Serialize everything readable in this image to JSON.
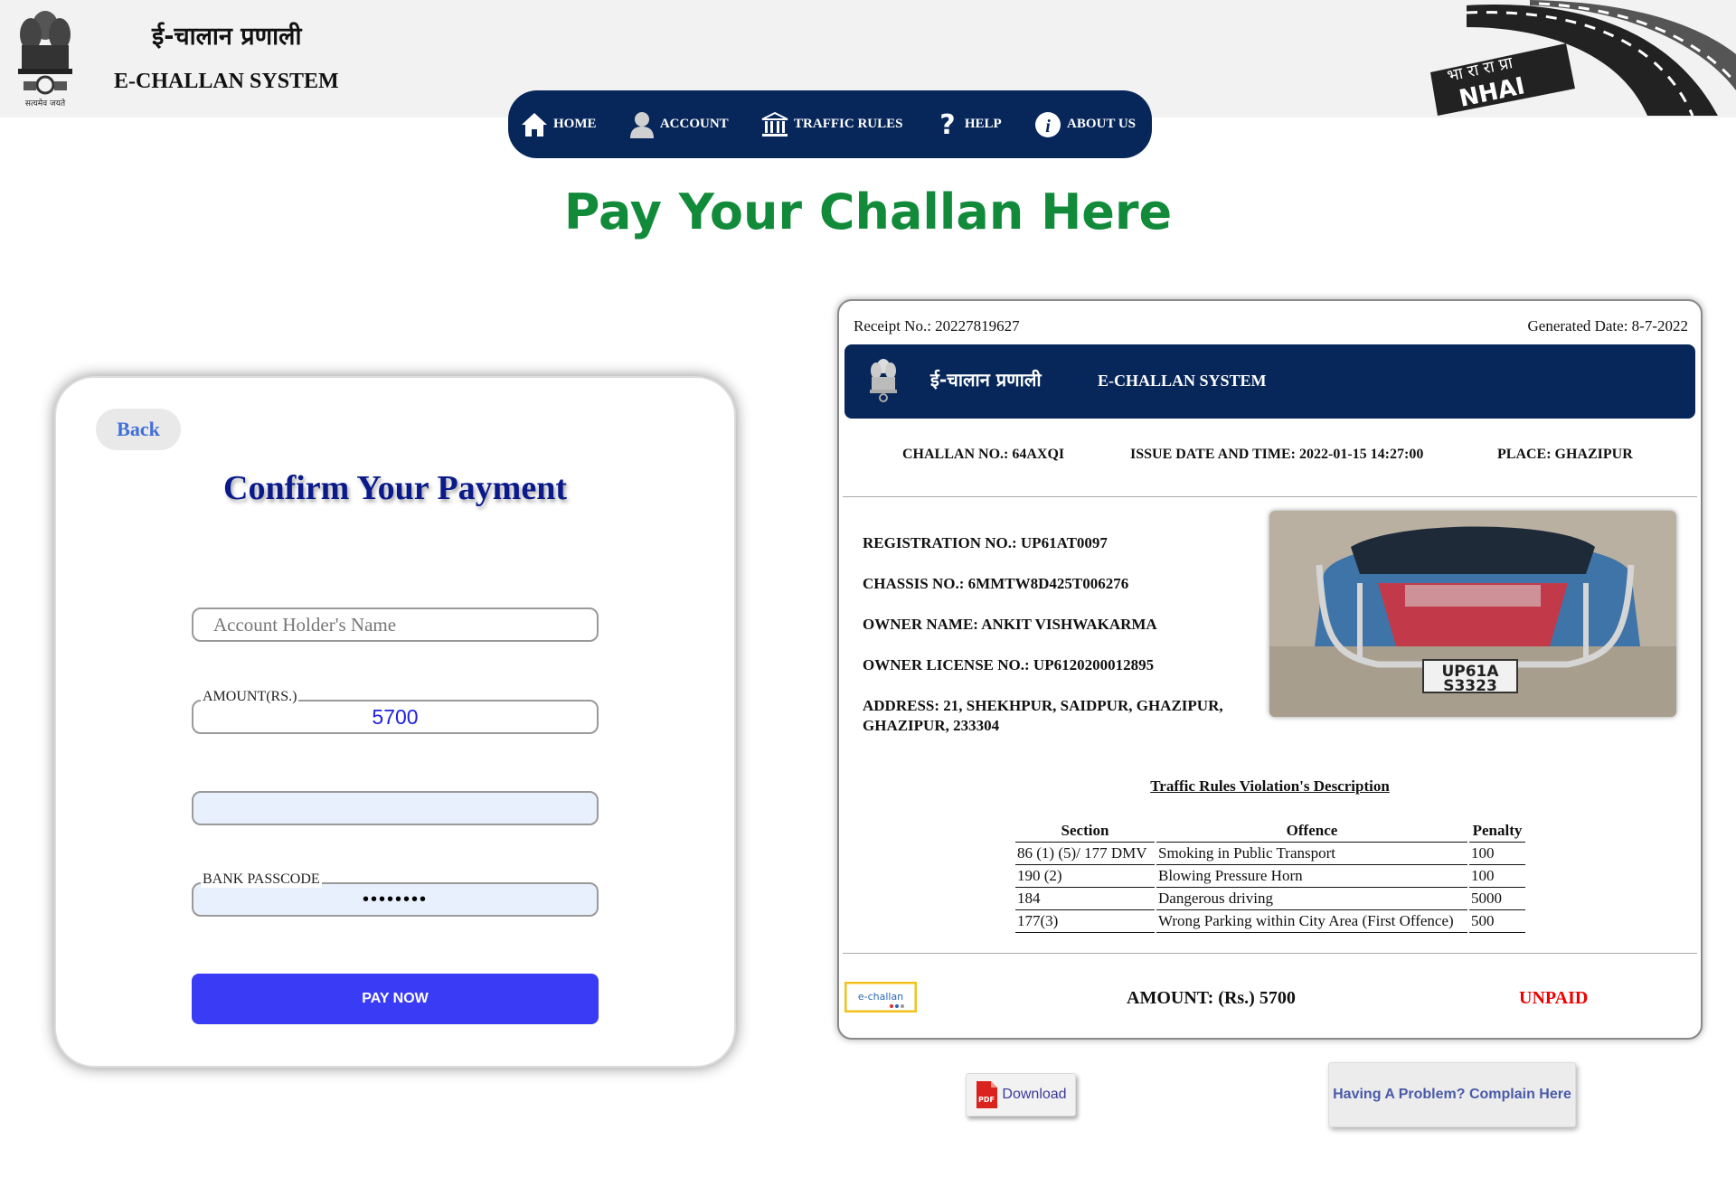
{
  "header": {
    "hindi_title": "ई-चालान प्रणाली",
    "english_title": "E-CHALLAN SYSTEM",
    "emblem_motto": "सत्यमेव जयते",
    "nhai_text": "NHAI",
    "nhai_hindi": "भा रा रा प्रा"
  },
  "nav": {
    "items": [
      {
        "label": "HOME",
        "icon": "home-icon"
      },
      {
        "label": "ACCOUNT",
        "icon": "user-icon"
      },
      {
        "label": "TRAFFIC RULES",
        "icon": "bank-building-icon"
      },
      {
        "label": "HELP",
        "icon": "question-icon"
      },
      {
        "label": "ABOUT US",
        "icon": "info-icon"
      }
    ],
    "bg_color": "#07275a"
  },
  "page_title": "Pay Your Challan Here",
  "payment": {
    "back_label": "Back",
    "title": "Confirm Your Payment",
    "name_placeholder": "Account Holder's Name",
    "name_value": "",
    "amount_label": "AMOUNT(RS.)",
    "amount_value": "5700",
    "blank_value": "",
    "passcode_label": "BANK PASSCODE",
    "passcode_value": "••••••••",
    "pay_button": "PAY NOW",
    "button_color": "#3a3cf5"
  },
  "receipt": {
    "receipt_no": "Receipt No.: 20227819627",
    "generated_date": "Generated Date: 8-7-2022",
    "band_hindi": "ई-चालान प्रणाली",
    "band_english": "E-CHALLAN SYSTEM",
    "challan_no": "CHALLAN NO.: 64AXQI",
    "issue_datetime": "ISSUE DATE AND TIME: 2022-01-15 14:27:00",
    "place": "PLACE: GHAZIPUR",
    "registration_no": "REGISTRATION NO.: UP61AT0097",
    "chassis_no": "CHASSIS NO.: 6MMTW8D425T006276",
    "owner_name": "OWNER NAME: ANKIT VISHWAKARMA",
    "owner_license": "OWNER LICENSE NO.: UP6120200012895",
    "address_line1": "ADDRESS: 21, SHEKHPUR, SAIDPUR, GHAZIPUR,",
    "address_line2": "GHAZIPUR, 233304",
    "plate_line1": "UP61A",
    "plate_line2": "S3323",
    "violation_title": "Traffic Rules Violation's Description",
    "table": {
      "headers": [
        "Section",
        "Offence",
        "Penalty"
      ],
      "rows": [
        [
          "86 (1) (5)/ 177 DMV",
          "Smoking in Public Transport",
          "100"
        ],
        [
          "190 (2)",
          "Blowing Pressure Horn",
          "100"
        ],
        [
          "184",
          "Dangerous driving",
          "5000"
        ],
        [
          "177(3)",
          "Wrong Parking within City Area (First Offence)",
          "500"
        ]
      ]
    },
    "logo_text": "e-challan",
    "amount": "AMOUNT: (Rs.) 5700",
    "status": "UNPAID",
    "status_color": "#f00000"
  },
  "actions": {
    "download_label": "Download",
    "pdf_badge": "PDF",
    "complain_label": "Having A Problem? Complain Here"
  }
}
